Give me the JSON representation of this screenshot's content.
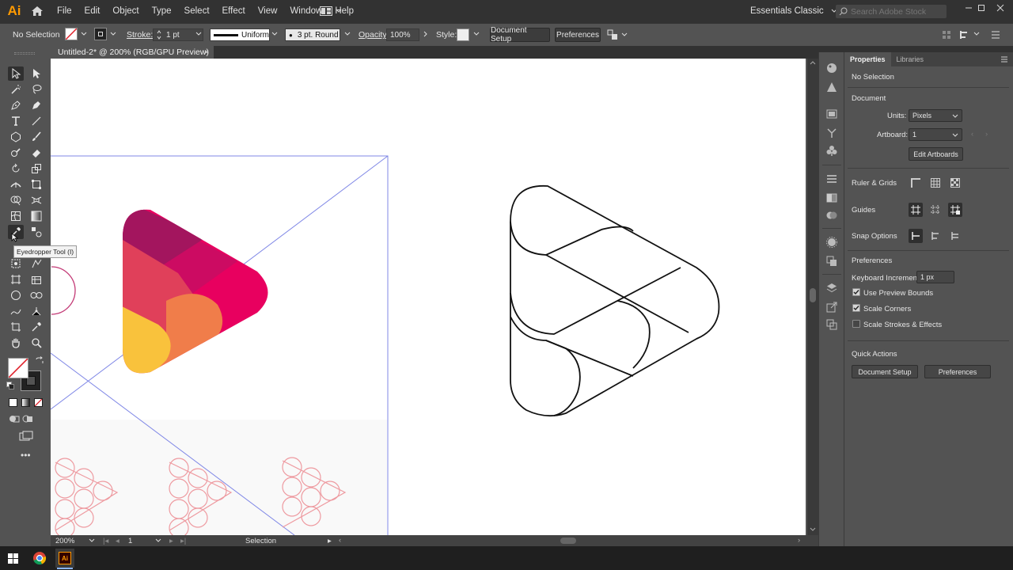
{
  "menubar": {
    "logo": "Ai",
    "items": [
      "File",
      "Edit",
      "Object",
      "Type",
      "Select",
      "Effect",
      "View",
      "Window",
      "Help"
    ],
    "workspace": "Essentials Classic",
    "search_placeholder": "Search Adobe Stock"
  },
  "control": {
    "selection": "No Selection",
    "stroke_label": "Stroke:",
    "stroke_weight": "1 pt",
    "stroke_profile": "Uniform",
    "brush": "3 pt. Round",
    "opacity_label": "Opacity:",
    "opacity": "100%",
    "style_label": "Style:",
    "document_setup": "Document Setup",
    "preferences": "Preferences"
  },
  "document_tab": {
    "title": "Untitled-2* @ 200% (RGB/GPU Preview)",
    "close": "×"
  },
  "tooltip": "Eyedropper Tool (I)",
  "status": {
    "zoom": "200%",
    "artboard": "1",
    "mode": "Selection"
  },
  "properties": {
    "tab_properties": "Properties",
    "tab_libraries": "Libraries",
    "selection": "No Selection",
    "document_heading": "Document",
    "units_label": "Units:",
    "units_value": "Pixels",
    "artboard_label": "Artboard:",
    "artboard_value": "1",
    "edit_artboards": "Edit Artboards",
    "ruler_grids": "Ruler & Grids",
    "guides": "Guides",
    "snap_options": "Snap Options",
    "preferences_heading": "Preferences",
    "keyboard_increment_label": "Keyboard Increment:",
    "keyboard_increment_value": "1 px",
    "use_preview_bounds": "Use Preview Bounds",
    "use_preview_bounds_checked": true,
    "scale_corners": "Scale Corners",
    "scale_corners_checked": true,
    "scale_strokes": "Scale Strokes & Effects",
    "scale_strokes_checked": false,
    "quick_actions": "Quick Actions",
    "document_setup": "Document Setup",
    "preferences": "Preferences"
  },
  "colors": {
    "logo_orange": "#ff9a00",
    "logo_yellow": "#f9c23c",
    "logo_orange2": "#f07d4a",
    "logo_red": "#e0405a",
    "logo_pink": "#e8005f",
    "logo_magenta": "#cc0b62",
    "logo_purple": "#a3155e",
    "guide_blue": "#7f87e6",
    "outline_pink": "#ee9aa0"
  }
}
